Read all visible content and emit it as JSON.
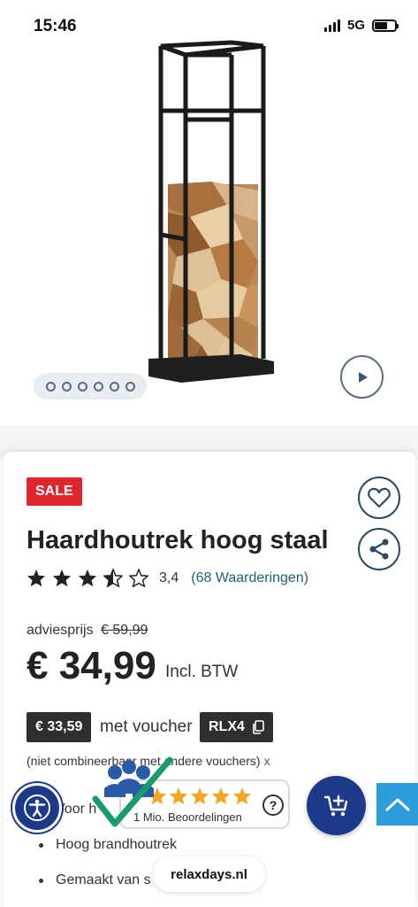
{
  "status_bar": {
    "time": "15:46",
    "network": "5G"
  },
  "gallery": {
    "dot_count": 6,
    "play_icon": "play-icon"
  },
  "product": {
    "badge": "SALE",
    "title": "Haardhoutrek hoog staal",
    "rating": {
      "stars": 3.5,
      "value": "3,4",
      "count_label": "(68 Waarderingen)"
    },
    "advice_label": "adviesprijs",
    "advice_price": "€ 59,99",
    "price": "€ 34,99",
    "vat_label": "Incl. BTW",
    "voucher": {
      "price": "€ 33,59",
      "label": "met voucher",
      "code": "RLX4",
      "note": "(niet combineerbaar met andere vouchers)",
      "close": "x"
    },
    "features": [
      "Voor h",
      "Hoog brandhoutrek",
      "Gemaakt van s"
    ]
  },
  "trust_widget": {
    "stars": 5,
    "label": "1 Mio. Beoordelingen",
    "help": "?"
  },
  "site_pill": "relaxdays.nl",
  "colors": {
    "sale": "#e0262d",
    "primary": "#1d3a8a",
    "scroll_top": "#2d9cdb",
    "accent_link": "#1f5f7a",
    "trust_star": "#f5a623"
  }
}
